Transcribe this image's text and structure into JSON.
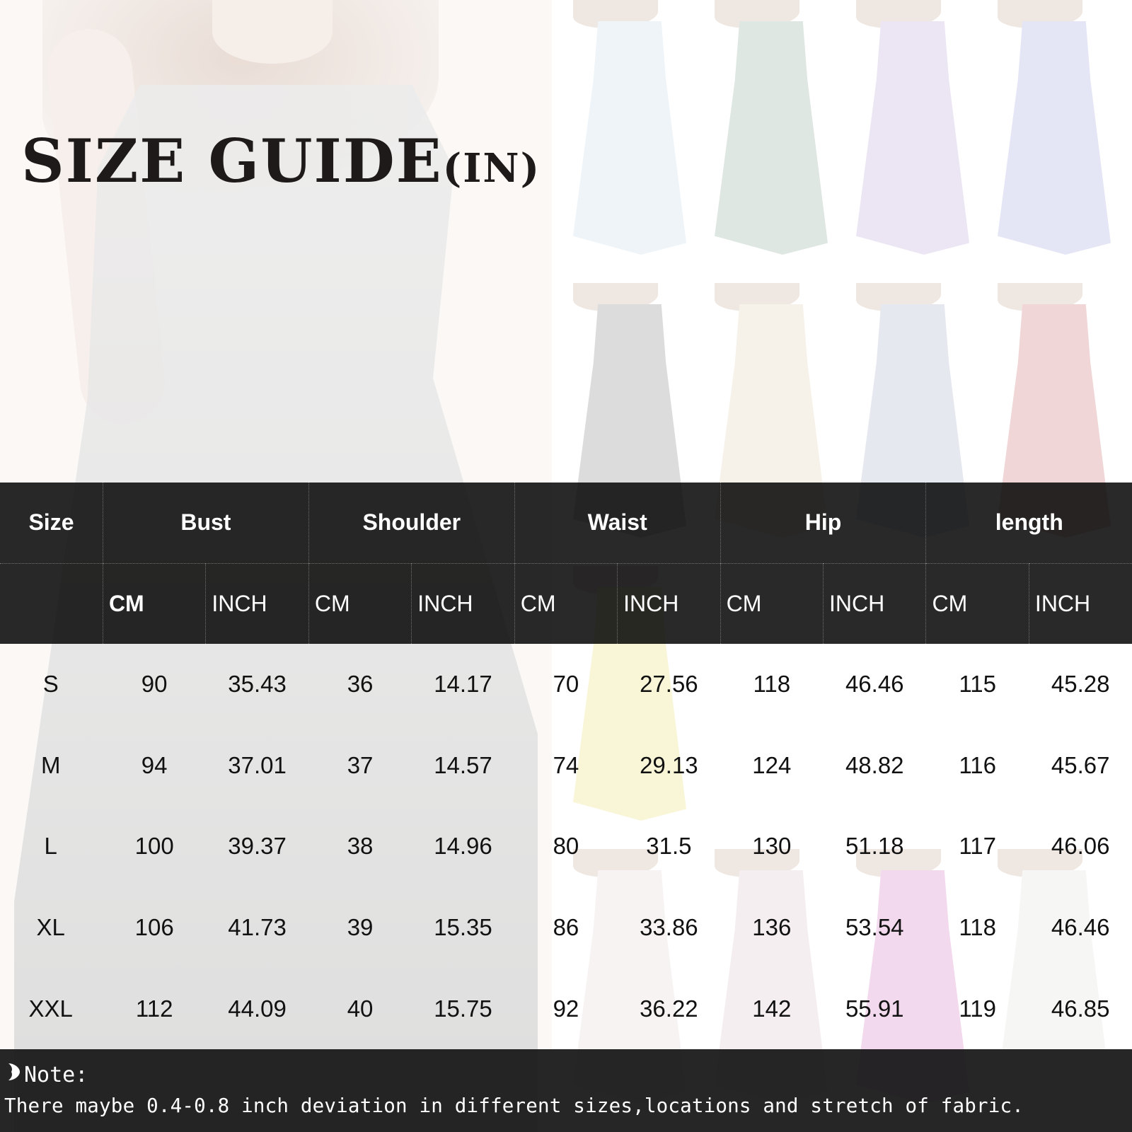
{
  "heading": {
    "main": "SIZE GUIDE",
    "suffix": "(IN)"
  },
  "table": {
    "group_headers": [
      "Size",
      "Bust",
      "Shoulder",
      "Waist",
      "Hip",
      "length"
    ],
    "unit_headers": [
      "",
      "CM",
      "INCH",
      "CM",
      "INCH",
      "CM",
      "INCH",
      "CM",
      "INCH",
      "CM",
      "INCH"
    ],
    "rows": [
      [
        "S",
        "90",
        "35.43",
        "36",
        "14.17",
        "70",
        "27.56",
        "118",
        "46.46",
        "115",
        "45.28"
      ],
      [
        "M",
        "94",
        "37.01",
        "37",
        "14.57",
        "74",
        "29.13",
        "124",
        "48.82",
        "116",
        "45.67"
      ],
      [
        "L",
        "100",
        "39.37",
        "38",
        "14.96",
        "80",
        "31.5",
        "130",
        "51.18",
        "117",
        "46.06"
      ],
      [
        "XL",
        "106",
        "41.73",
        "39",
        "15.35",
        "86",
        "33.86",
        "136",
        "53.54",
        "118",
        "46.46"
      ],
      [
        "XXL",
        "112",
        "44.09",
        "40",
        "15.75",
        "92",
        "36.22",
        "142",
        "55.91",
        "119",
        "46.85"
      ]
    ]
  },
  "note": {
    "icon": "heart-bullet-icon",
    "label": "Note:",
    "text": "There maybe 0.4-0.8 inch deviation in different sizes,locations and stretch of fabric."
  },
  "colors": {
    "header_bg": "#000000",
    "note_bg": "#141414",
    "thumb_dresses": [
      "#eef4f8",
      "#dfe7e2",
      "#ece6f4",
      "#e4e6f6",
      "#dcdcdc",
      "#f6f2ea",
      "#e6e8f0",
      "#f0d6d6",
      "#f9f6d8",
      "#f7f3f2",
      "#f4eef0",
      "#f3d9ee",
      "#f6f6f4"
    ]
  }
}
